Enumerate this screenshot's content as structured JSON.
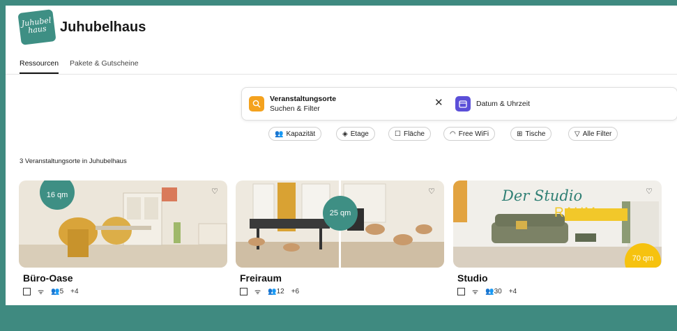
{
  "brand": {
    "logo_text": "Juhubel haus",
    "name": "Juhubelhaus"
  },
  "tabs": [
    {
      "label": "Ressourcen"
    },
    {
      "label": "Pakete & Gutscheine"
    }
  ],
  "search": {
    "title": "Veranstaltungsorte",
    "subtitle": "Suchen & Filter",
    "clear": "✕",
    "date_label": "Datum & Uhrzeit"
  },
  "filters": [
    {
      "label": "Kapazität",
      "icon": "people-icon"
    },
    {
      "label": "Etage",
      "icon": "layers-icon"
    },
    {
      "label": "Fläche",
      "icon": "square-icon"
    },
    {
      "label": "Free WiFi",
      "icon": "wifi-icon"
    },
    {
      "label": "Tische",
      "icon": "table-icon"
    },
    {
      "label": "Alle Filter",
      "icon": "filter-icon"
    }
  ],
  "result_count": "3 Veranstaltungsorte in Juhubelhaus",
  "cards": [
    {
      "title": "Büro-Oase",
      "badge": "16 qm",
      "capacity": "5",
      "extra": "+4"
    },
    {
      "title": "Freiraum",
      "badge": "25 qm",
      "capacity": "12",
      "extra": "+6"
    },
    {
      "title": "Studio",
      "badge": "70 qm",
      "capacity": "30",
      "extra": "+4",
      "image_text_1": "Der Studio",
      "image_text_2": "RAUM"
    }
  ],
  "colors": {
    "brand_teal": "#3e8f84",
    "search_orange": "#f4a21e",
    "date_purple": "#5b4fd8",
    "badge_yellow": "#f6c20f"
  }
}
